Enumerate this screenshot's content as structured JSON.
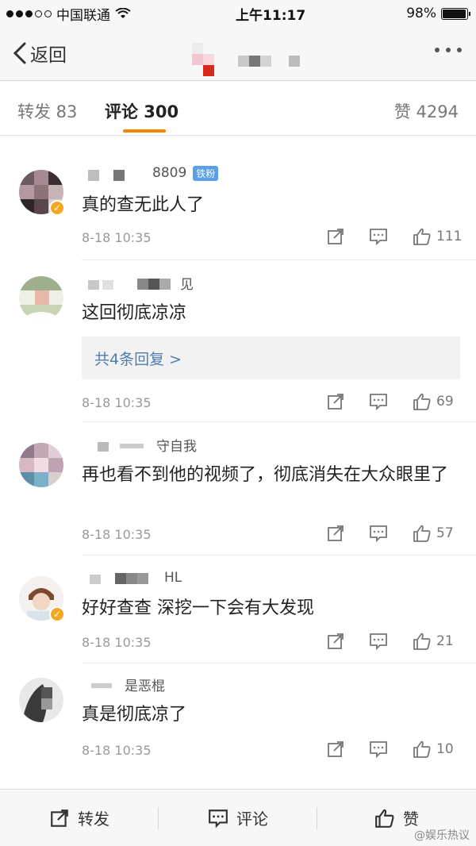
{
  "status_bar": {
    "carrier": "中国联通",
    "time": "上午11:17",
    "battery_text": "98%",
    "battery_level": 0.98
  },
  "nav": {
    "back_label": "返回"
  },
  "tabs": {
    "repost": "转发 83",
    "comments": "评论 300",
    "likes": "赞 4294"
  },
  "comments": [
    {
      "name_suffix": "8809",
      "badge": "铁粉",
      "verified": true,
      "text": "真的查无此人了",
      "time": "8-18 10:35",
      "likes": "111"
    },
    {
      "name_suffix": "见",
      "verified": false,
      "text": "这回彻底凉凉",
      "reply_summary": "共4条回复 >",
      "time": "8-18 10:35",
      "likes": "69"
    },
    {
      "name_suffix": "守自我",
      "verified": false,
      "text": "再也看不到他的视频了，彻底消失在大众眼里了",
      "time": "8-18 10:35",
      "likes": "57"
    },
    {
      "name_suffix": "HL",
      "verified": true,
      "text": "好好查查 深挖一下会有大发现",
      "time": "8-18 10:35",
      "likes": "21"
    },
    {
      "name_suffix": "是恶棍",
      "verified": false,
      "text": "真是彻底凉了",
      "time": "8-18 10:35",
      "likes": "10"
    }
  ],
  "bottom_bar": {
    "repost_label": "转发",
    "comment_label": "评论",
    "like_label": "赞"
  },
  "watermark": "@娱乐热议",
  "icons": [
    "back-chevron-icon",
    "more-icon",
    "share-icon",
    "comment-icon",
    "thumb-up-icon",
    "wifi-icon",
    "battery-icon"
  ],
  "colors": {
    "accent": "#ff8200",
    "link": "#507daf",
    "badge": "#5aa0e6",
    "verified": "#f5a623"
  }
}
